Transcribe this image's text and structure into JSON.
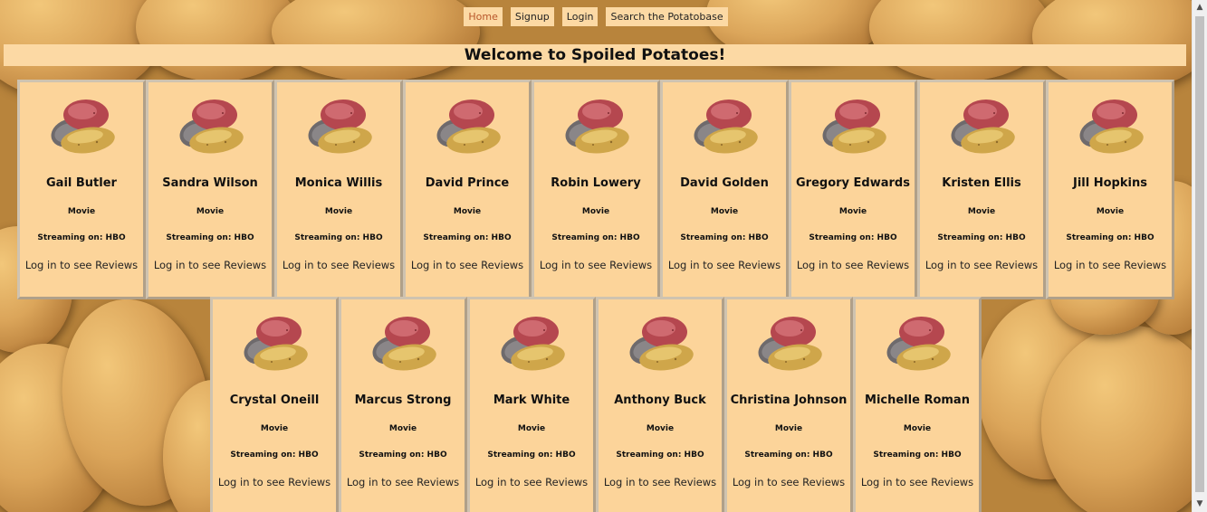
{
  "nav": {
    "items": [
      {
        "label": "Home",
        "name": "nav-home-link",
        "active": true
      },
      {
        "label": "Signup",
        "name": "nav-signup-link",
        "active": false
      },
      {
        "label": "Login",
        "name": "nav-login-link",
        "active": false
      },
      {
        "label": "Search the Potatobase",
        "name": "nav-search-link",
        "active": false
      }
    ]
  },
  "banner": {
    "title": "Welcome to Spoiled Potatoes!"
  },
  "cards": [
    {
      "name": "Gail Butler",
      "type": "Movie",
      "streaming": "Streaming on: HBO",
      "reviews": "Log in to see Reviews"
    },
    {
      "name": "Sandra Wilson",
      "type": "Movie",
      "streaming": "Streaming on: HBO",
      "reviews": "Log in to see Reviews"
    },
    {
      "name": "Monica Willis",
      "type": "Movie",
      "streaming": "Streaming on: HBO",
      "reviews": "Log in to see Reviews"
    },
    {
      "name": "David Prince",
      "type": "Movie",
      "streaming": "Streaming on: HBO",
      "reviews": "Log in to see Reviews"
    },
    {
      "name": "Robin Lowery",
      "type": "Movie",
      "streaming": "Streaming on: HBO",
      "reviews": "Log in to see Reviews"
    },
    {
      "name": "David Golden",
      "type": "Movie",
      "streaming": "Streaming on: HBO",
      "reviews": "Log in to see Reviews"
    },
    {
      "name": "Gregory Edwards",
      "type": "Movie",
      "streaming": "Streaming on: HBO",
      "reviews": "Log in to see Reviews"
    },
    {
      "name": "Kristen Ellis",
      "type": "Movie",
      "streaming": "Streaming on: HBO",
      "reviews": "Log in to see Reviews"
    },
    {
      "name": "Jill Hopkins",
      "type": "Movie",
      "streaming": "Streaming on: HBO",
      "reviews": "Log in to see Reviews"
    },
    {
      "name": "Crystal Oneill",
      "type": "Movie",
      "streaming": "Streaming on: HBO",
      "reviews": "Log in to see Reviews"
    },
    {
      "name": "Marcus Strong",
      "type": "Movie",
      "streaming": "Streaming on: HBO",
      "reviews": "Log in to see Reviews"
    },
    {
      "name": "Mark White",
      "type": "Movie",
      "streaming": "Streaming on: HBO",
      "reviews": "Log in to see Reviews"
    },
    {
      "name": "Anthony Buck",
      "type": "Movie",
      "streaming": "Streaming on: HBO",
      "reviews": "Log in to see Reviews"
    },
    {
      "name": "Christina Johnson",
      "type": "Movie",
      "streaming": "Streaming on: HBO",
      "reviews": "Log in to see Reviews"
    },
    {
      "name": "Michelle Roman",
      "type": "Movie",
      "streaming": "Streaming on: HBO",
      "reviews": "Log in to see Reviews"
    }
  ],
  "colors": {
    "card_bg": "#fcd49a",
    "nav_bg": "#fcd9a4",
    "active_link": "#b8562a"
  }
}
